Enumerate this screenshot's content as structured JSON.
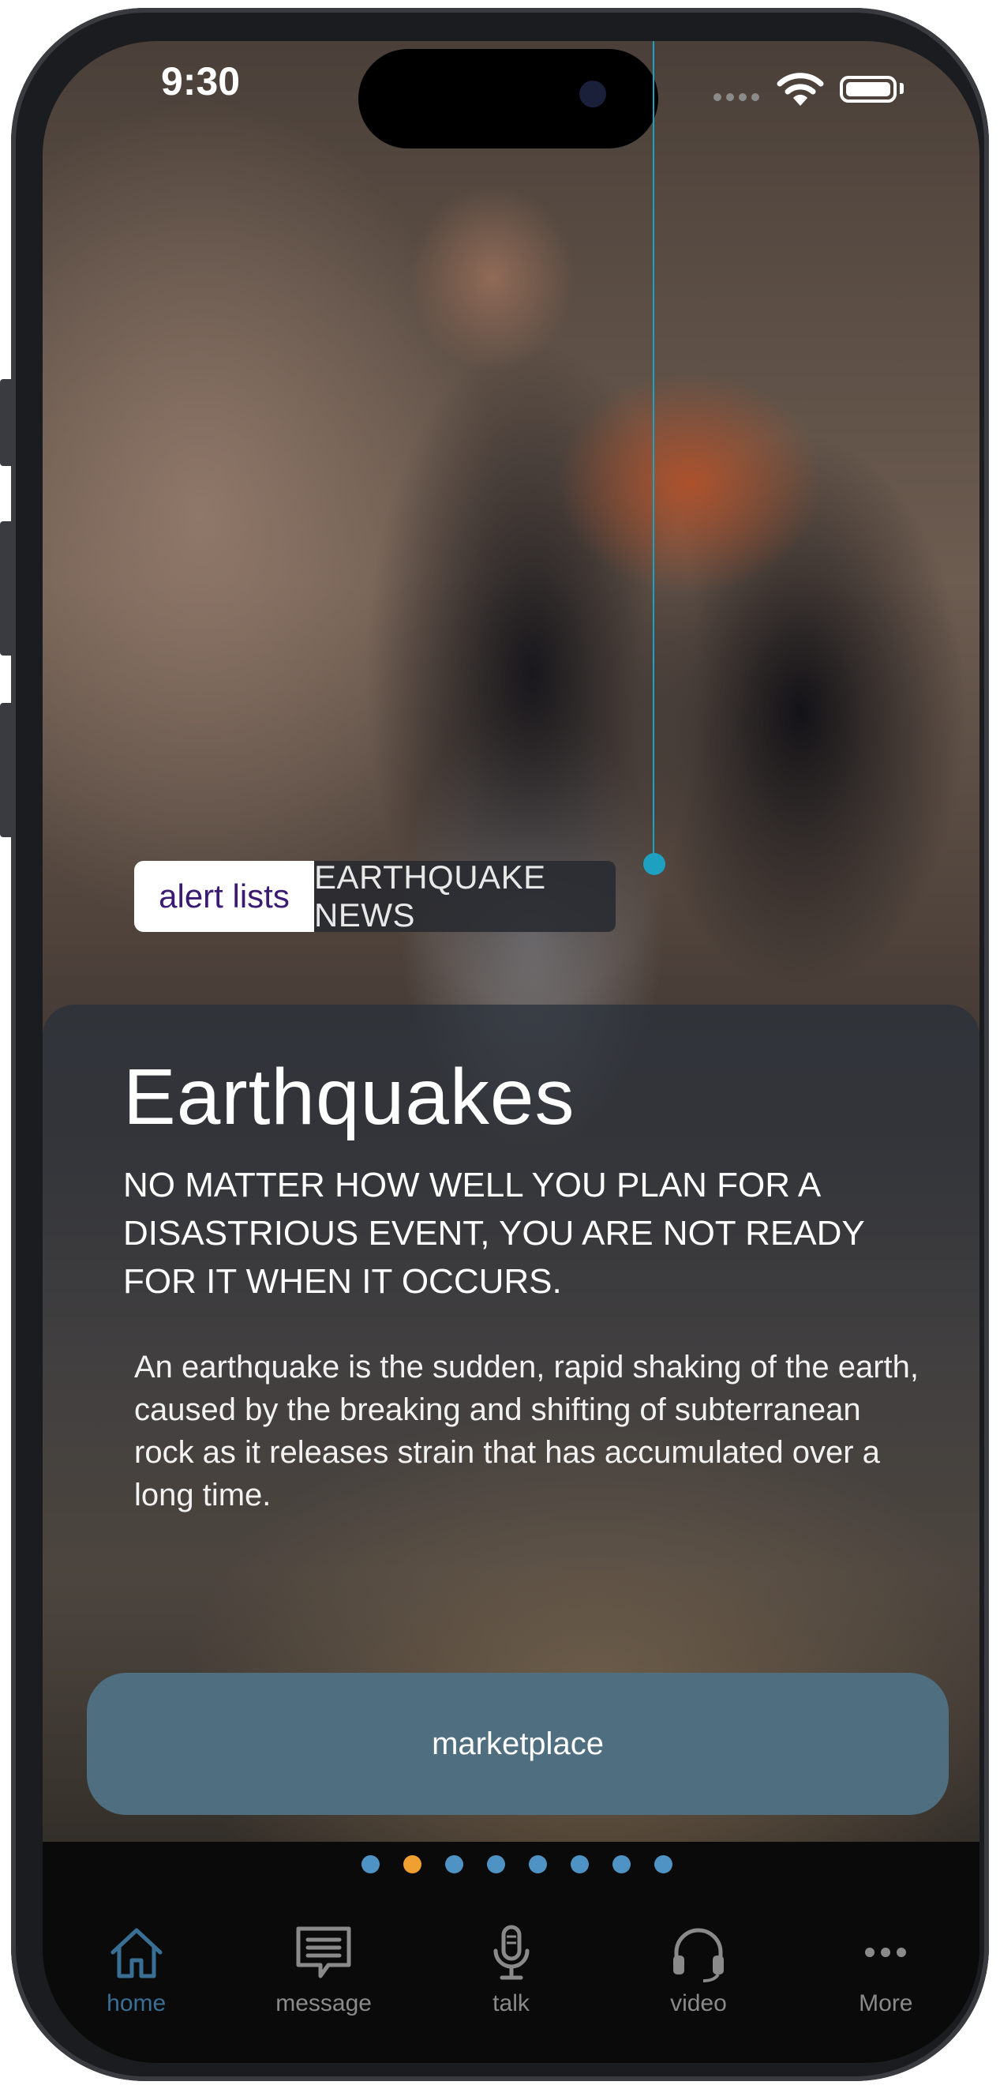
{
  "status": {
    "time": "9:30"
  },
  "tabs": {
    "alert_lists": "alert lists",
    "earthquake_news": "EARTHQUAKE NEWS"
  },
  "content": {
    "title": "Earthquakes",
    "subtitle": "NO MATTER HOW WELL YOU PLAN FOR A DISASTRIOUS EVENT, YOU ARE NOT READY FOR IT WHEN IT OCCURS.",
    "body": "An earthquake is the sudden, rapid shaking of the earth, caused by the breaking and shifting of subterranean rock as it releases strain that has accumulated over a long time."
  },
  "marketplace_button": "marketplace",
  "pager": {
    "count": 8,
    "active_index": 1
  },
  "tabbar": [
    {
      "label": "home",
      "icon": "home-icon"
    },
    {
      "label": "message",
      "icon": "message-icon"
    },
    {
      "label": "talk",
      "icon": "microphone-icon"
    },
    {
      "label": "video",
      "icon": "headphones-icon"
    },
    {
      "label": "More",
      "icon": "more-icon"
    }
  ],
  "colors": {
    "accent": "#3a6f95",
    "button": "#4f6e80",
    "tab_active_text": "#3a1a72",
    "pager_active": "#f0a030",
    "pager_inactive": "#4f93c4",
    "marker": "#1ea0c0"
  }
}
